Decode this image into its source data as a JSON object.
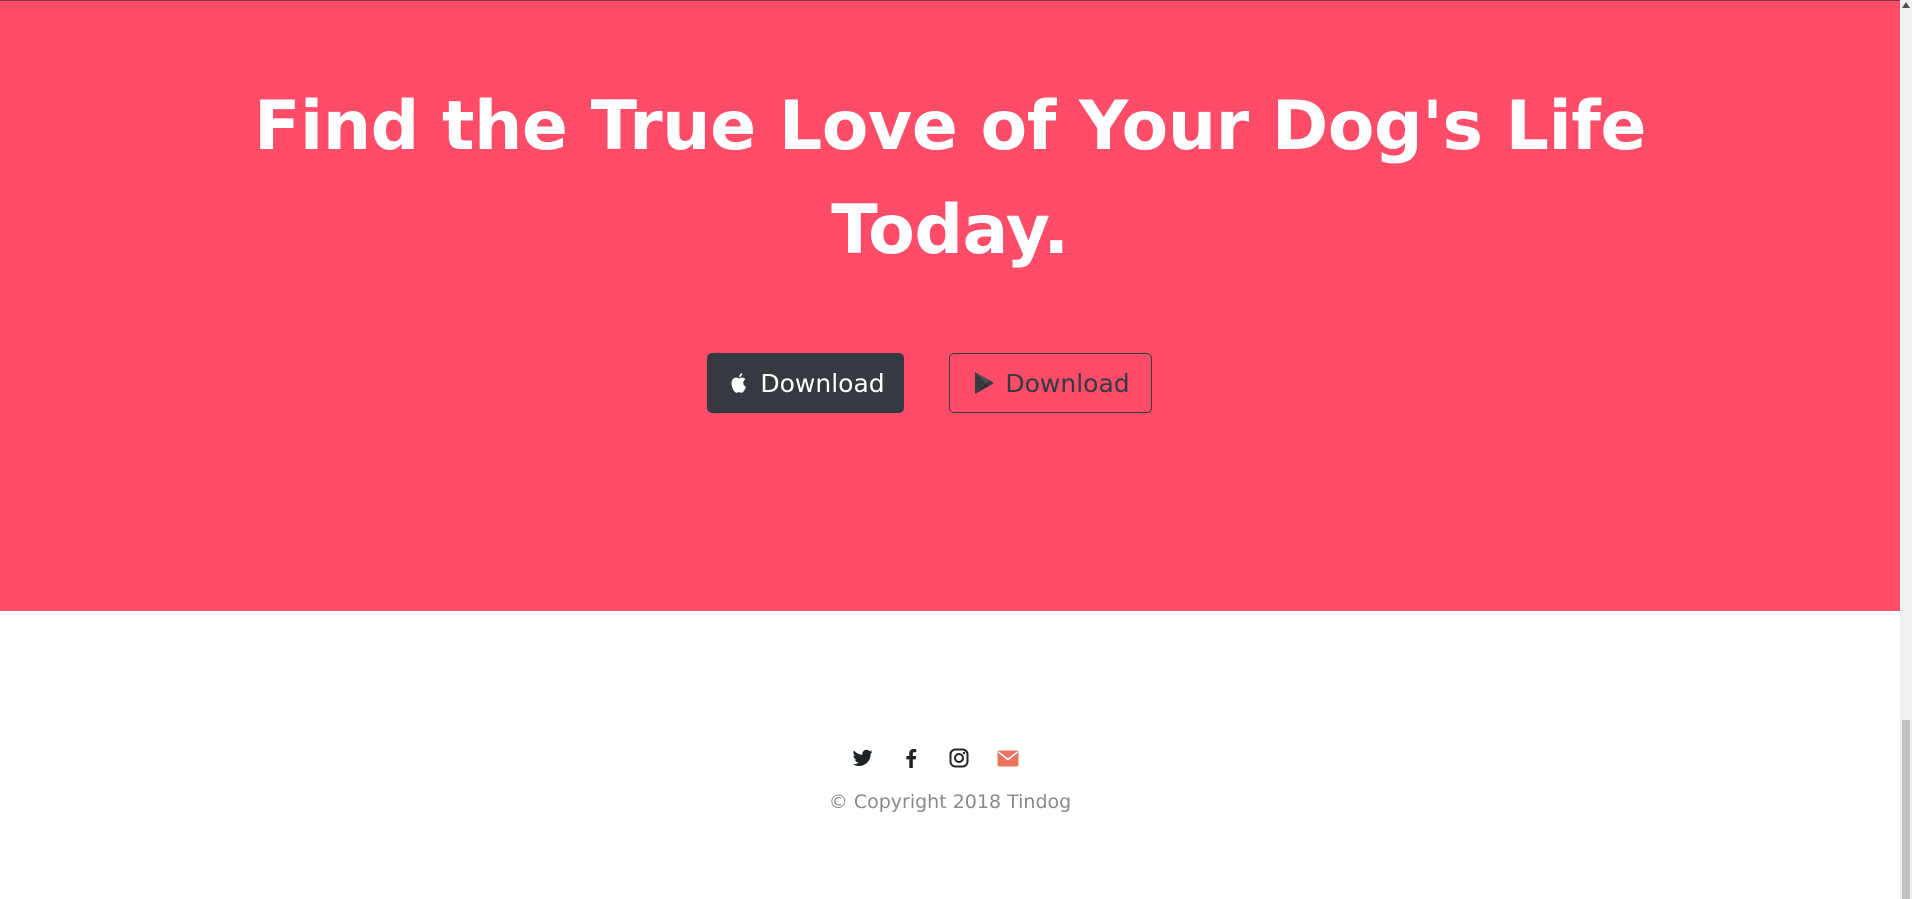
{
  "cta": {
    "title": "Find the True Love of Your Dog's Life Today.",
    "background_color": "#ff4c68",
    "apple_button": {
      "label": "Download",
      "icon": "apple-icon",
      "color": "#343a40"
    },
    "play_button": {
      "label": "Download",
      "icon": "google-play-icon",
      "color": "#343a40"
    }
  },
  "footer": {
    "social": [
      {
        "name": "twitter",
        "icon": "twitter-icon"
      },
      {
        "name": "facebook",
        "icon": "facebook-icon"
      },
      {
        "name": "instagram",
        "icon": "instagram-icon"
      },
      {
        "name": "email",
        "icon": "envelope-icon",
        "color": "#e8735e"
      }
    ],
    "copyright": "© Copyright 2018 Tindog"
  }
}
